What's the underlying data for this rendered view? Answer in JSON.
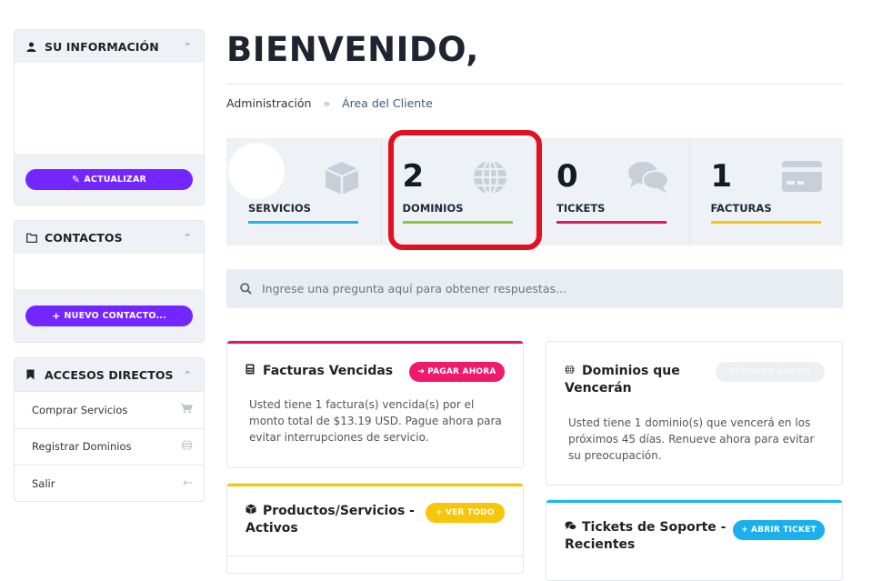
{
  "sidebar": {
    "info": {
      "title": "SU INFORMACIÓN",
      "button": "ACTUALIZAR"
    },
    "contacts": {
      "title": "CONTACTOS",
      "button": "NUEVO CONTACTO..."
    },
    "shortcuts": {
      "title": "ACCESOS DIRECTOS",
      "items": [
        {
          "label": "Comprar Servicios",
          "icon": "cart-icon"
        },
        {
          "label": "Registrar Dominios",
          "icon": "globe-icon"
        },
        {
          "label": "Salir",
          "icon": "arrow-left-icon"
        }
      ]
    }
  },
  "header": {
    "title": "BIENVENIDO,",
    "breadcrumb": {
      "home": "Administración",
      "separator": "»",
      "current": "Área del Cliente"
    }
  },
  "stats": [
    {
      "label": "SERVICIOS",
      "value": "",
      "color": "#1ab8ea",
      "icon": "box-icon"
    },
    {
      "label": "DOMINIOS",
      "value": "2",
      "color": "#8cc63f",
      "icon": "globe-icon"
    },
    {
      "label": "TICKETS",
      "value": "0",
      "color": "#e8175d",
      "icon": "comments-icon"
    },
    {
      "label": "FACTURAS",
      "value": "1",
      "color": "#f2c80f",
      "icon": "credit-card-icon"
    }
  ],
  "search": {
    "placeholder": "Ingrese una pregunta aquí para obtener respuestas..."
  },
  "cards": {
    "overdue": {
      "title": "Facturas Vencidas",
      "button": "PAGAR AHORA",
      "body": "Usted tiene 1 factura(s) vencida(s) por el monto total de $13.19 USD. Pague ahora para evitar interrupciones de servicio.",
      "color": "#e8175d"
    },
    "domains": {
      "title": "Dominios que Vencerán",
      "button": "RENOVAR AHORA",
      "body": "Usted tiene 1 dominio(s) que vencerá en los próximos 45 días. Renueve ahora para evitar su preocupación."
    },
    "products": {
      "title": "Productos/Servicios - Activos",
      "button": "VER TODO",
      "color": "#f2c80f"
    },
    "tickets": {
      "title": "Tickets de Soporte - Recientes",
      "button": "ABRIR TICKET",
      "color": "#1ab8ea"
    }
  },
  "colors": {
    "purple": "#7326ff",
    "highlight": "#e4101f"
  }
}
